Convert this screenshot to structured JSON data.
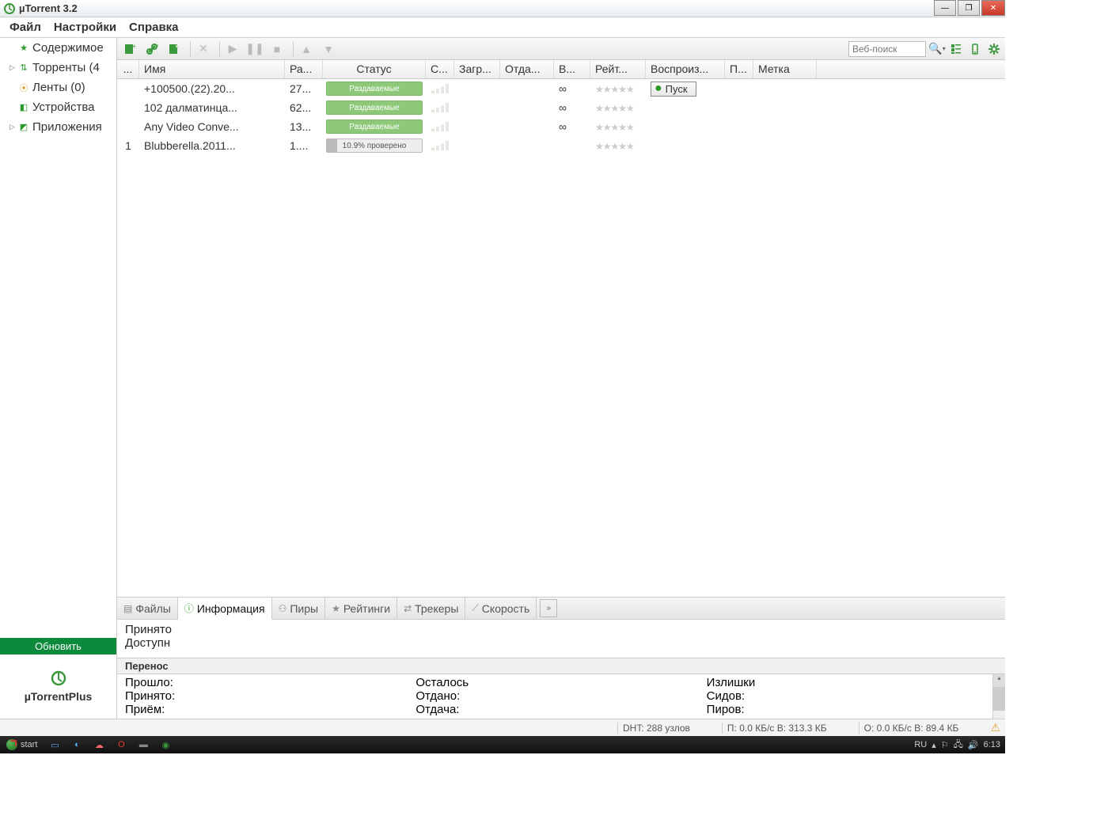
{
  "titlebar": {
    "title": "µTorrent 3.2"
  },
  "menubar": {
    "items": [
      "Файл",
      "Настройки",
      "Справка"
    ]
  },
  "sidebar": {
    "items": [
      {
        "expander": "",
        "glyph": "★",
        "glyphColor": "#2a9a2a",
        "label": "Содержимое"
      },
      {
        "expander": "▷",
        "glyph": "⇅",
        "glyphColor": "#2a9a2a",
        "label": "Торренты (4"
      },
      {
        "expander": "",
        "glyph": "⦿",
        "glyphColor": "#e0a030",
        "label": "Ленты (0)"
      },
      {
        "expander": "",
        "glyph": "◧",
        "glyphColor": "#2a9a2a",
        "label": "Устройства"
      },
      {
        "expander": "▷",
        "glyph": "◩",
        "glyphColor": "#2a9a2a",
        "label": "Приложения"
      }
    ],
    "update_label": "Обновить",
    "plus_label": "µTorrentPlus"
  },
  "toolbar": {
    "search_placeholder": "Веб-поиск"
  },
  "table": {
    "headers": [
      "...",
      "Имя",
      "Ра...",
      "Статус",
      "С...",
      "Загр...",
      "Отда...",
      "В...",
      "Рейт...",
      "Воспроиз...",
      "П...",
      "Метка"
    ],
    "rows": [
      {
        "num": "",
        "name": "+100500.(22).20...",
        "size": "27...",
        "status": "Раздаваемые",
        "statusType": "seed",
        "speed": "∞",
        "play": "Пуск"
      },
      {
        "num": "",
        "name": "102 далматинца...",
        "size": "62...",
        "status": "Раздаваемые",
        "statusType": "seed",
        "speed": "∞",
        "play": ""
      },
      {
        "num": "",
        "name": "Any Video Conve...",
        "size": "13...",
        "status": "Раздаваемые",
        "statusType": "seed",
        "speed": "∞",
        "play": ""
      },
      {
        "num": "1",
        "name": "Blubberella.2011...",
        "size": "1....",
        "status": "10.9% проверено",
        "statusType": "check",
        "speed": "",
        "play": ""
      }
    ]
  },
  "detail": {
    "tabs": [
      "Файлы",
      "Информация",
      "Пиры",
      "Рейтинги",
      "Трекеры",
      "Скорость"
    ],
    "active_tab": 1,
    "info_lines": [
      "Принято",
      "Доступн"
    ],
    "transfer_label": "Перенос",
    "transfer_cols": [
      [
        "Прошло:",
        "Принято:",
        "Приём:"
      ],
      [
        "Осталось",
        "Отдано:",
        "Отдача:"
      ],
      [
        "Излишки",
        "Сидов:",
        "Пиров:"
      ]
    ]
  },
  "app_status": {
    "dht": "DHT: 288 узлов",
    "down": "П: 0.0 КБ/с В: 313.3 КБ",
    "up": "О: 0.0 КБ/с В: 89.4 КБ"
  },
  "taskbar": {
    "start": "start",
    "lang": "RU",
    "clock": "6:13"
  }
}
